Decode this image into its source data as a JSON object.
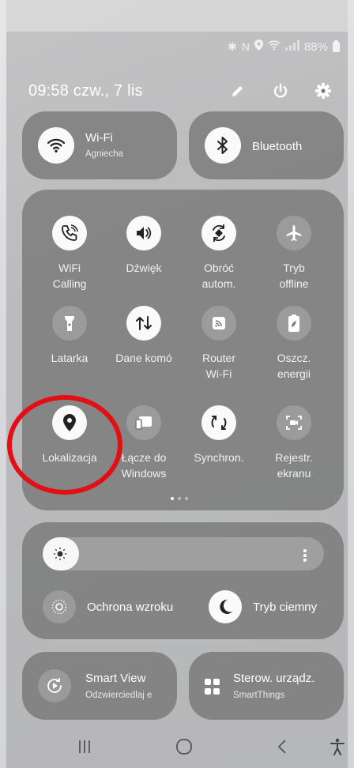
{
  "status_bar": {
    "icons": [
      "bluetooth-icon",
      "nfc-icon",
      "location-icon",
      "wifi-calling-icon",
      "signal-icon"
    ],
    "battery": "88%"
  },
  "header": {
    "datetime": "09:58  czw., 7 lis",
    "icons": [
      "edit-icon",
      "power-icon",
      "settings-icon"
    ]
  },
  "wifi": {
    "title": "Wi-Fi",
    "network": "Agniecha",
    "state": "on"
  },
  "bluetooth": {
    "title": "Bluetooth",
    "state": "off"
  },
  "quick_tiles": [
    {
      "label": "WiFi\nCalling",
      "icon": "wifi-calling-icon",
      "state": "on"
    },
    {
      "label": "Dźwięk",
      "icon": "sound-icon",
      "state": "on"
    },
    {
      "label": "Obróć\nautom.",
      "icon": "auto-rotate-icon",
      "state": "on"
    },
    {
      "label": "Tryb\noffline",
      "icon": "airplane-icon",
      "state": "off"
    },
    {
      "label": "Latarka",
      "icon": "flashlight-icon",
      "state": "off"
    },
    {
      "label": "Dane komó",
      "icon": "mobile-data-icon",
      "state": "on"
    },
    {
      "label": "Router\nWi-Fi",
      "icon": "hotspot-icon",
      "state": "off"
    },
    {
      "label": "Oszcz.\nenergii",
      "icon": "power-saving-icon",
      "state": "off"
    },
    {
      "label": "Lokalizacja",
      "icon": "location-icon",
      "state": "on"
    },
    {
      "label": "Łącze do\nWindows",
      "icon": "link-to-windows-icon",
      "state": "off"
    },
    {
      "label": "Synchron.",
      "icon": "sync-icon",
      "state": "on"
    },
    {
      "label": "Rejestr.\nekranu",
      "icon": "screen-recorder-icon",
      "state": "off"
    }
  ],
  "pagination": {
    "pages": 3,
    "current": 1
  },
  "brightness": {
    "level": 0.13,
    "more_label": "⋮"
  },
  "eye_comfort": {
    "label": "Ochrona wzroku",
    "icon": "eye-comfort-icon"
  },
  "dark_mode": {
    "label": "Tryb ciemny",
    "icon": "dark-mode-icon"
  },
  "smart_view": {
    "title": "Smart View",
    "subtitle": "Odzwierciedlaj e",
    "icon": "smart-view-icon"
  },
  "smartthings": {
    "title": "Sterow. urządz.",
    "subtitle": "SmartThings",
    "icon": "device-control-icon"
  },
  "navbar": {
    "buttons": [
      "recents-icon",
      "home-icon",
      "back-icon",
      "accessibility-icon"
    ]
  },
  "highlight": {
    "target": "Lokalizacja",
    "color": "#e30f14"
  }
}
